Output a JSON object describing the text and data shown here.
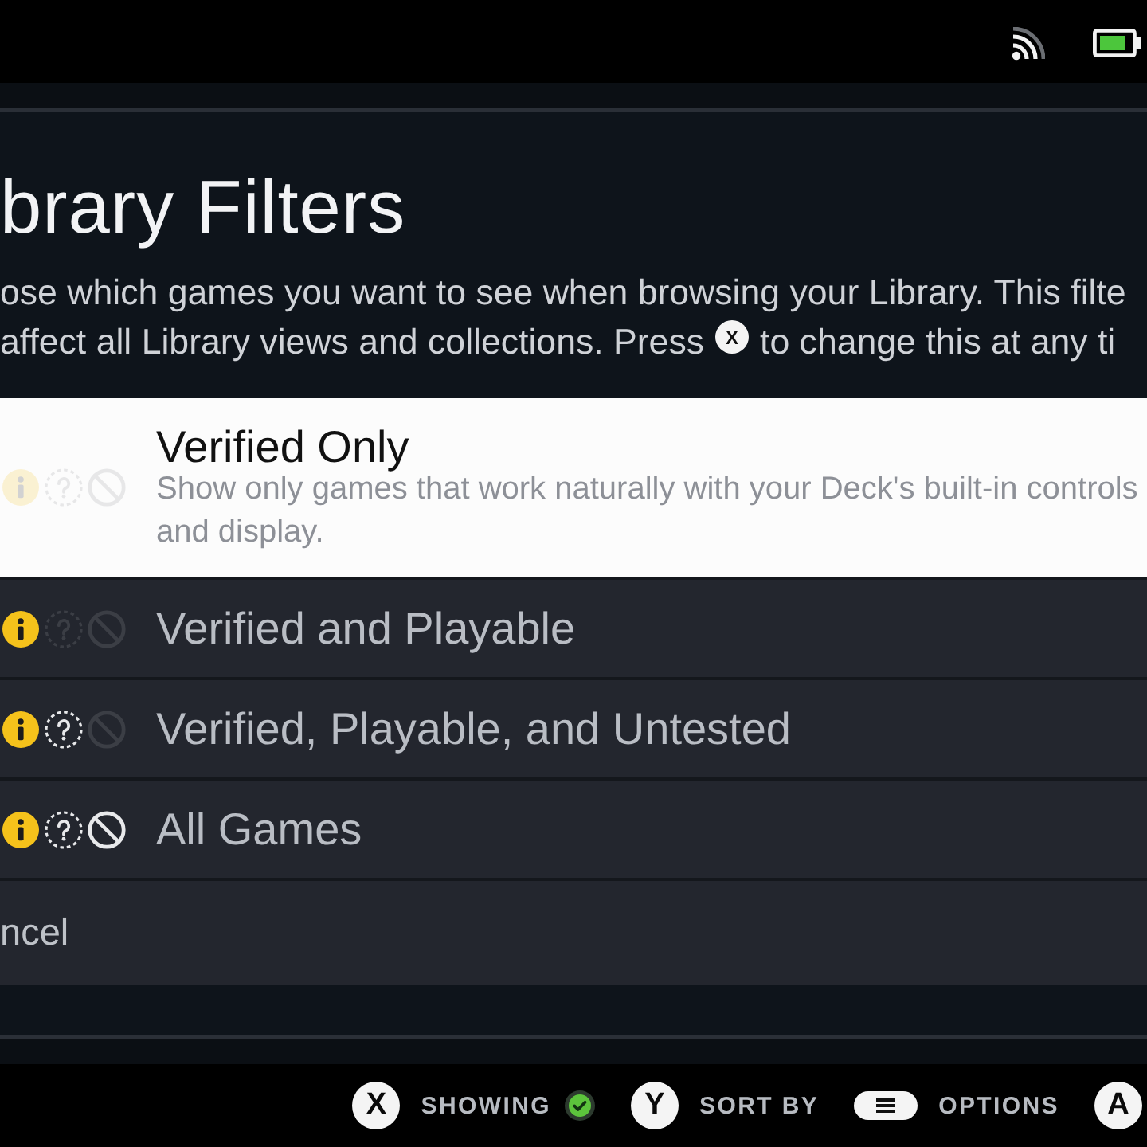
{
  "header": {
    "title": "brary Filters",
    "description_lines": [
      {
        "parts": [
          {
            "kind": "text",
            "text": "ose which games you want to see when browsing your Library. This filte"
          }
        ]
      },
      {
        "parts": [
          {
            "kind": "text",
            "text": "affect all Library views and collections. Press"
          },
          {
            "kind": "glyph",
            "text": "X"
          },
          {
            "kind": "text",
            "text": "to change this at any ti"
          }
        ]
      }
    ]
  },
  "options": [
    {
      "label": "Verified Only",
      "description": "Show only games that work naturally with your Deck's built-in controls and display.",
      "selected": true,
      "icons": [
        {
          "kind": "info",
          "on": false
        },
        {
          "kind": "question",
          "on": false
        },
        {
          "kind": "blocked",
          "on": false
        }
      ]
    },
    {
      "label": "Verified and Playable",
      "selected": false,
      "icons": [
        {
          "kind": "info",
          "on": true
        },
        {
          "kind": "question",
          "on": false
        },
        {
          "kind": "blocked",
          "on": false
        }
      ]
    },
    {
      "label": "Verified, Playable, and Untested",
      "selected": false,
      "icons": [
        {
          "kind": "info",
          "on": true
        },
        {
          "kind": "question",
          "on": true
        },
        {
          "kind": "blocked",
          "on": false
        }
      ]
    },
    {
      "label": "All Games",
      "selected": false,
      "icons": [
        {
          "kind": "info",
          "on": true
        },
        {
          "kind": "question",
          "on": true
        },
        {
          "kind": "blocked",
          "on": true
        }
      ]
    }
  ],
  "cancel": {
    "label": "ncel"
  },
  "footer": {
    "hints": [
      {
        "kind": "status_button",
        "glyph": "X",
        "label": "SHOWING"
      },
      {
        "kind": "button",
        "glyph": "Y",
        "label": "SORT BY"
      },
      {
        "kind": "menu",
        "label": "OPTIONS"
      },
      {
        "kind": "button",
        "glyph": "A"
      }
    ]
  }
}
